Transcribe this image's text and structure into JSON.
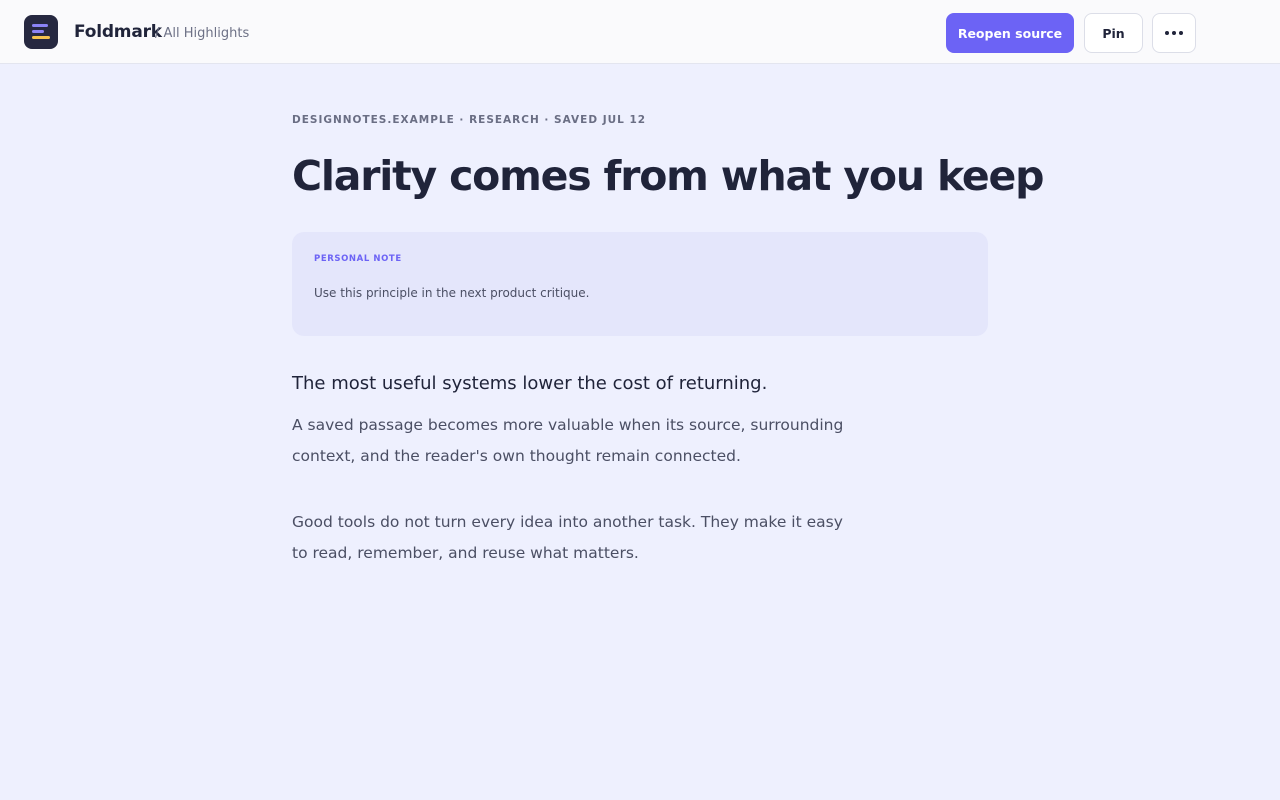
{
  "app": {
    "name": "Foldmark",
    "breadcrumb": "/ All Highlights",
    "logo_icon": "app-logo-icon"
  },
  "toolbar": {
    "reopen_label": "Reopen source",
    "pin_label": "Pin",
    "more_icon": "ellipsis-icon"
  },
  "article": {
    "meta": "DESIGNNOTES.EXAMPLE · RESEARCH · SAVED JUL 12",
    "title": "Clarity comes from what you keep",
    "note": {
      "label": "PERSONAL NOTE",
      "text": "Use this principle in the next product critique."
    },
    "highlight": "The most useful systems lower the cost of returning.",
    "paragraphs": [
      "A saved passage becomes more valuable when its source, surrounding context, and the reader's own thought remain connected.",
      "Good tools do not turn every idea into another task. They make it easy to read, remember, and reuse what matters."
    ]
  },
  "colors": {
    "accent": "#6c63f5",
    "background": "#eef0fe",
    "note_background": "#e4e6fb",
    "text": "#20243a",
    "logo_yellow": "#f2c14e"
  }
}
